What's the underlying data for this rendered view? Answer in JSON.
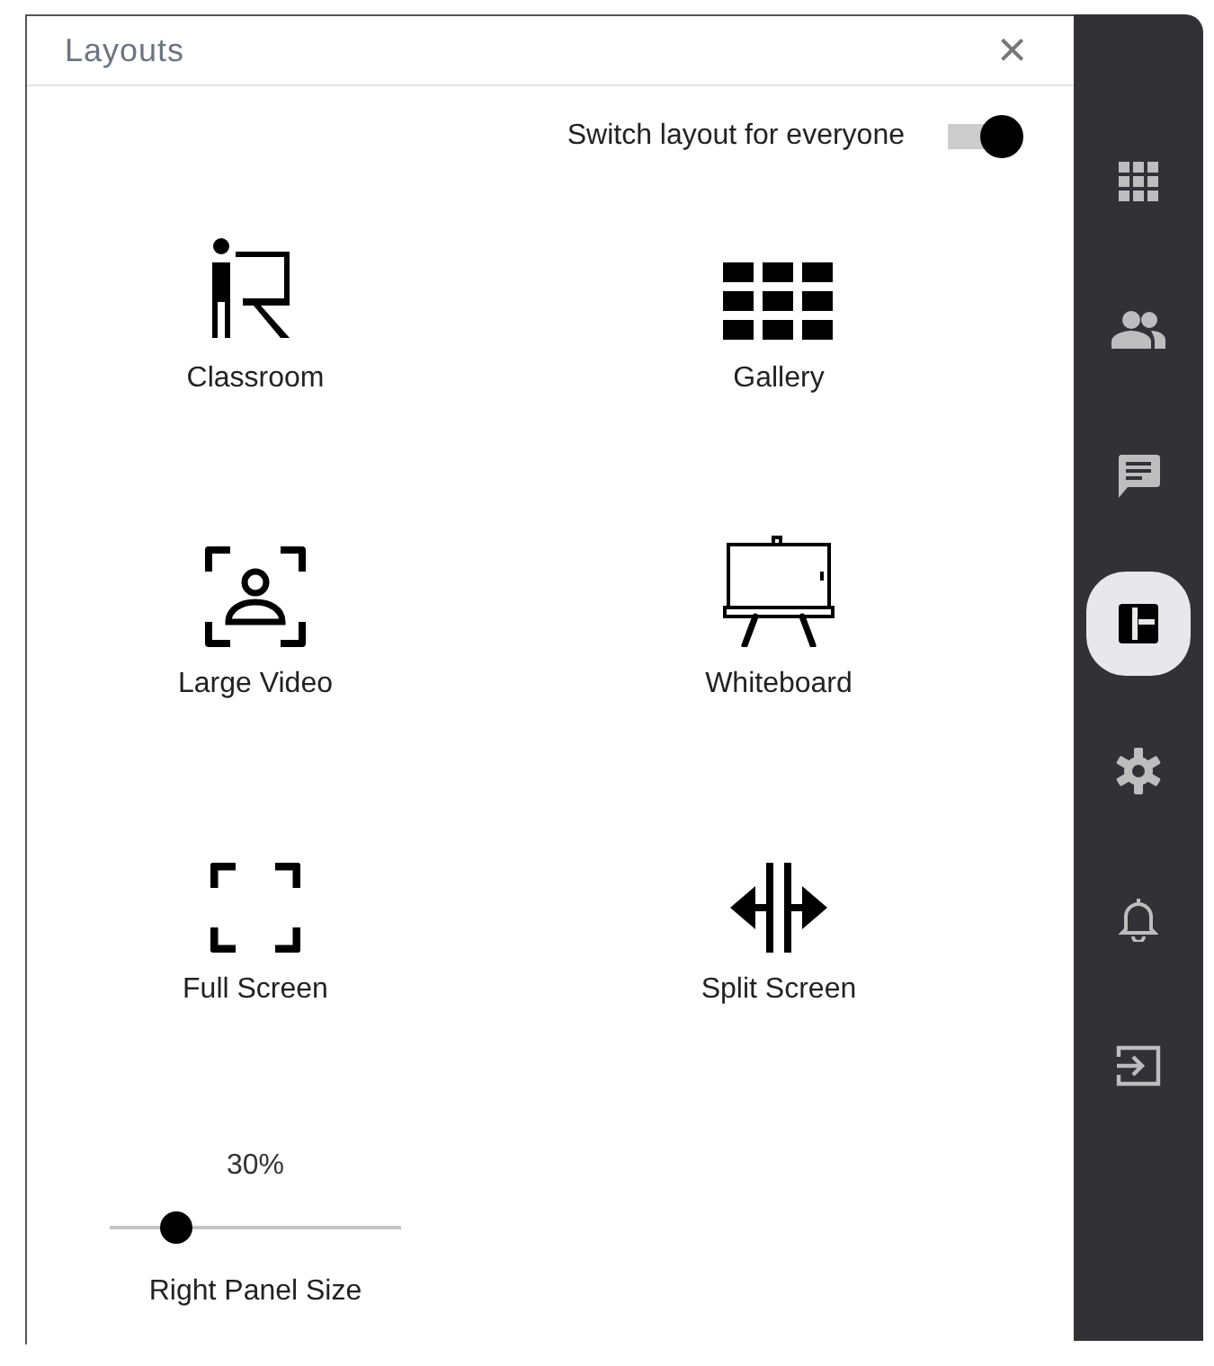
{
  "panel": {
    "title": "Layouts",
    "close": "×"
  },
  "switch": {
    "label": "Switch layout for everyone",
    "on": true
  },
  "layouts": [
    {
      "label": "Classroom",
      "kind": "classroom"
    },
    {
      "label": "Gallery",
      "kind": "gallery"
    },
    {
      "label": "Large Video",
      "kind": "video"
    },
    {
      "label": "Whiteboard",
      "kind": "whiteboard"
    },
    {
      "label": "Full Screen",
      "kind": "fullscreen"
    },
    {
      "label": "Split Screen",
      "kind": "split"
    }
  ],
  "slider": {
    "reading": "30%",
    "level": 0.23,
    "label": "Right Panel Size"
  },
  "sidebar": {
    "items": [
      {
        "kind": "grid",
        "selected": false
      },
      {
        "kind": "people",
        "selected": false
      },
      {
        "kind": "chat",
        "selected": false
      },
      {
        "kind": "layout",
        "selected": true
      },
      {
        "kind": "settings",
        "selected": false
      },
      {
        "kind": "bell",
        "selected": false
      },
      {
        "kind": "exit",
        "selected": false
      }
    ]
  }
}
